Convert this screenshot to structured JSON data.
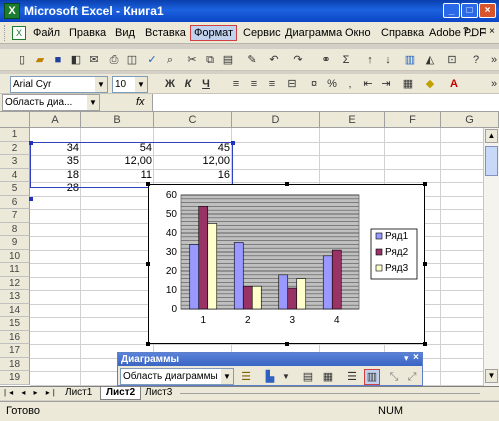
{
  "window": {
    "title": "Microsoft Excel - Книга1",
    "minimize": "_",
    "maximize": "□",
    "close": "×"
  },
  "menu": {
    "items": [
      "Файл",
      "Правка",
      "Вид",
      "Вставка",
      "Формат",
      "Сервис",
      "Диаграмма",
      "Окно",
      "Справка",
      "Adobe PDF"
    ],
    "active_index": 4,
    "question_label": "?",
    "minimize": "_",
    "restore": "□",
    "close": "×"
  },
  "format_toolbar": {
    "font": "Arial Cyr",
    "size": "10",
    "bold": "Ж",
    "italic": "К",
    "underline": "Ч"
  },
  "formula_bar": {
    "name_box": "Область диа...",
    "fx": "fx"
  },
  "grid": {
    "columns": [
      "A",
      "B",
      "C",
      "D",
      "E",
      "F",
      "G"
    ],
    "rows": [
      "1",
      "2",
      "3",
      "4",
      "5",
      "6",
      "7",
      "8",
      "9",
      "10",
      "11",
      "12",
      "13",
      "14",
      "15",
      "16",
      "17",
      "18",
      "19"
    ],
    "cells": [
      [
        "34",
        "54",
        "45"
      ],
      [
        "35",
        "12,00",
        "12,00"
      ],
      [
        "18",
        "11",
        "16"
      ],
      [
        "28",
        "",
        ""
      ]
    ]
  },
  "chart_data": {
    "type": "bar",
    "categories": [
      "1",
      "2",
      "3",
      "4"
    ],
    "series": [
      {
        "name": "Ряд1",
        "values": [
          34,
          35,
          18,
          28
        ],
        "color": "#9999ff"
      },
      {
        "name": "Ряд2",
        "values": [
          54,
          12,
          11,
          31
        ],
        "color": "#993366"
      },
      {
        "name": "Ряд3",
        "values": [
          45,
          12,
          16,
          0
        ],
        "color": "#ffffcc"
      }
    ],
    "yticks": [
      "0",
      "10",
      "20",
      "30",
      "40",
      "50",
      "60"
    ],
    "ylim": [
      0,
      60
    ],
    "grid": true,
    "legend": "right",
    "plot_area_color": "#c0c0c0"
  },
  "chart_toolbar": {
    "title": "Диаграммы",
    "dropdown": "Область диаграммы"
  },
  "sheet_tabs": {
    "tabs": [
      "Лист1",
      "Лист2",
      "Лист3"
    ],
    "active_index": 1
  },
  "status": {
    "text": "Готово",
    "num": "NUM"
  }
}
